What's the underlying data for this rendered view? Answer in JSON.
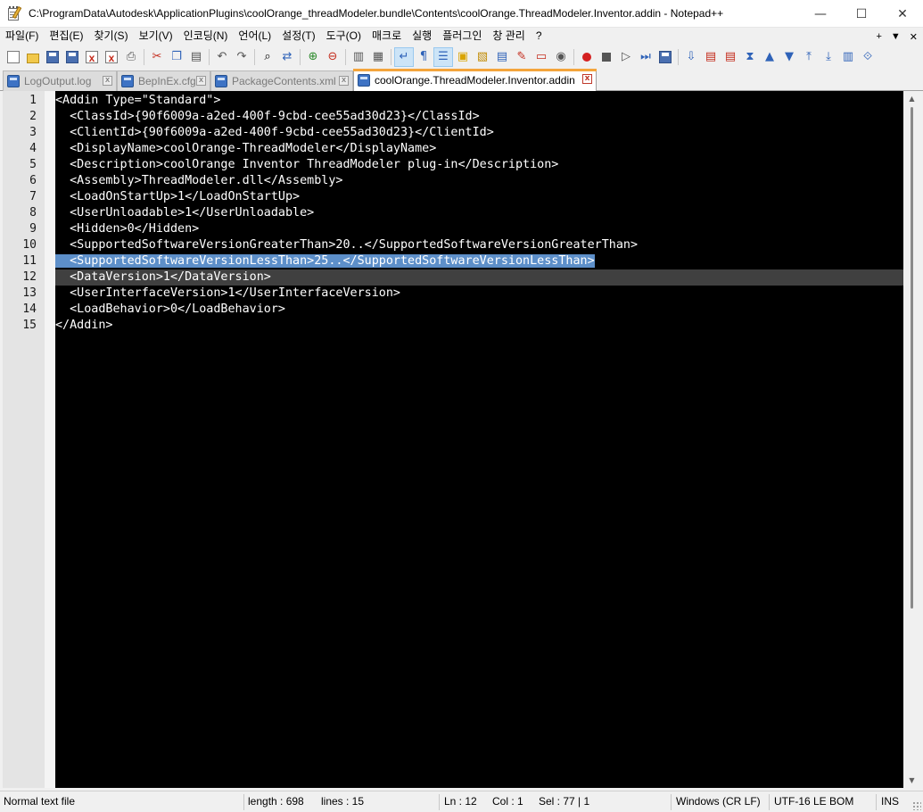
{
  "window": {
    "title": "C:\\ProgramData\\Autodesk\\ApplicationPlugins\\coolOrange_threadModeler.bundle\\Contents\\coolOrange.ThreadModeler.Inventor.addin - Notepad++",
    "controls": {
      "minimize": "—",
      "maximize": "☐",
      "close": "✕"
    }
  },
  "menu": {
    "items": [
      "파일(F)",
      "편집(E)",
      "찾기(S)",
      "보기(V)",
      "인코딩(N)",
      "언어(L)",
      "설정(T)",
      "도구(O)",
      "매크로",
      "실행",
      "플러그인",
      "창 관리",
      "?"
    ],
    "right": {
      "plus": "+",
      "dropdown": "▼",
      "close": "✕"
    }
  },
  "toolbar": {
    "icons": [
      "new-file-icon",
      "open-file-icon",
      "save-icon",
      "save-all-icon",
      "close-icon",
      "close-all-icon",
      "print-icon",
      "cut-icon",
      "copy-icon",
      "paste-icon",
      "undo-icon",
      "redo-icon",
      "find-icon",
      "replace-icon",
      "zoom-in-icon",
      "zoom-out-icon",
      "sync-vertical-icon",
      "sync-horizontal-icon",
      "word-wrap-icon",
      "show-all-chars-icon",
      "indent-guide-icon",
      "doc-map-icon",
      "function-list-icon",
      "folder-workspace-icon",
      "monitoring-icon",
      "record-macro-icon",
      "stop-macro-icon",
      "play-macro-icon",
      "run-macro-multiple-icon",
      "save-macro-icon"
    ]
  },
  "tabs": [
    {
      "label": "LogOutput.log",
      "active": false
    },
    {
      "label": "BepInEx.cfg",
      "active": false
    },
    {
      "label": "PackageContents.xml",
      "active": false
    },
    {
      "label": "coolOrange.ThreadModeler.Inventor.addin",
      "active": true
    }
  ],
  "editor": {
    "lines": [
      {
        "num": "1",
        "text": "<Addin Type=\"Standard\">"
      },
      {
        "num": "2",
        "text": "  <ClassId>{90f6009a-a2ed-400f-9cbd-cee55ad30d23}</ClassId>"
      },
      {
        "num": "3",
        "text": "  <ClientId>{90f6009a-a2ed-400f-9cbd-cee55ad30d23}</ClientId>"
      },
      {
        "num": "4",
        "text": "  <DisplayName>coolOrange-ThreadModeler</DisplayName>"
      },
      {
        "num": "5",
        "text": "  <Description>coolOrange Inventor ThreadModeler plug-in</Description>"
      },
      {
        "num": "6",
        "text": "  <Assembly>ThreadModeler.dll</Assembly>"
      },
      {
        "num": "7",
        "text": "  <LoadOnStartUp>1</LoadOnStartUp>"
      },
      {
        "num": "8",
        "text": "  <UserUnloadable>1</UserUnloadable>"
      },
      {
        "num": "9",
        "text": "  <Hidden>0</Hidden>"
      },
      {
        "num": "10",
        "text": "  <SupportedSoftwareVersionGreaterThan>20..</SupportedSoftwareVersionGreaterThan>"
      },
      {
        "num": "11",
        "text": "  <SupportedSoftwareVersionLessThan>25..</SupportedSoftwareVersionLessThan>",
        "selected": true
      },
      {
        "num": "12",
        "text": "  <DataVersion>1</DataVersion>",
        "current": true
      },
      {
        "num": "13",
        "text": "  <UserInterfaceVersion>1</UserInterfaceVersion>"
      },
      {
        "num": "14",
        "text": "  <LoadBehavior>0</LoadBehavior>"
      },
      {
        "num": "15",
        "text": "</Addin>"
      }
    ],
    "colors": {
      "background": "#000000",
      "foreground": "#ffffff",
      "selection": "#5d8fc9",
      "current_line": "#404040"
    }
  },
  "statusbar": {
    "file_type": "Normal text file",
    "length": "length : 698",
    "lines": "lines : 15",
    "ln": "Ln : 12",
    "col": "Col : 1",
    "sel": "Sel : 77 | 1",
    "eol": "Windows (CR LF)",
    "encoding": "UTF-16 LE BOM",
    "mode": "INS"
  },
  "accent": {
    "active_tab": "#f4a53c"
  }
}
